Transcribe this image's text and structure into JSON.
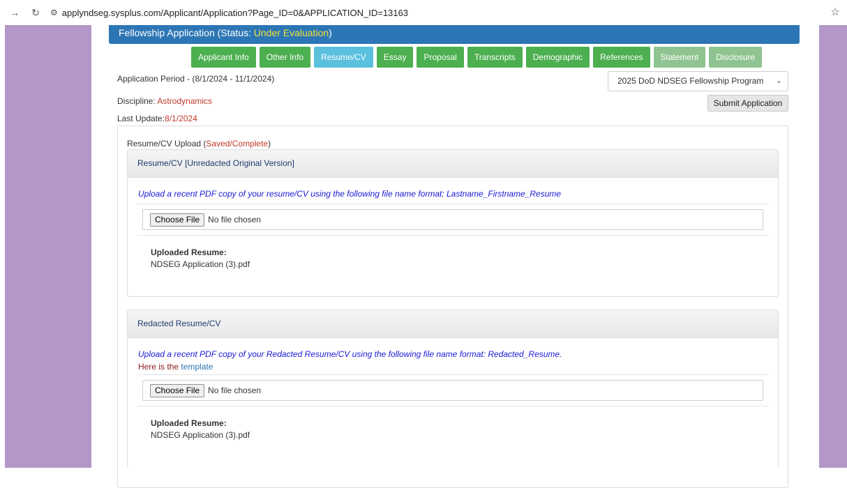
{
  "browser": {
    "url": "applyndseg.sysplus.com/Applicant/Application?Page_ID=0&APPLICATION_ID=13163"
  },
  "header": {
    "title_prefix": "Fellowship Application (Status: ",
    "status": "Under Evaluation",
    "title_suffix": ")"
  },
  "tabs": [
    {
      "label": "Applicant Info",
      "state": "normal"
    },
    {
      "label": "Other Info",
      "state": "normal"
    },
    {
      "label": "Resume/CV",
      "state": "active"
    },
    {
      "label": "Essay",
      "state": "normal"
    },
    {
      "label": "Proposal",
      "state": "normal"
    },
    {
      "label": "Transcripts",
      "state": "normal"
    },
    {
      "label": "Demographic",
      "state": "normal"
    },
    {
      "label": "References",
      "state": "normal"
    },
    {
      "label": "Statement",
      "state": "muted"
    },
    {
      "label": "Disclosure",
      "state": "muted"
    }
  ],
  "info": {
    "period": "Application Period - (8/1/2024 - 11/1/2024)",
    "discipline_label": "Discipline: ",
    "discipline": "Astrodynamics",
    "last_update_label": "Last Update:",
    "last_update": "8/1/2024",
    "program_selected": "2025 DoD NDSEG Fellowship Program",
    "submit_label": "Submit Application"
  },
  "upload": {
    "title": "Resume/CV Upload (",
    "status": "Saved/Complete",
    "title_end": ")"
  },
  "panels": {
    "original": {
      "heading": "Resume/CV [Unredacted Original Version]",
      "instruction": "Upload a recent PDF copy of your resume/CV using the following file name format: Lastname_Firstname_Resume",
      "choose_label": "Choose File",
      "no_file": "No file chosen",
      "uploaded_label": "Uploaded Resume:",
      "uploaded_file": "NDSEG Application (3).pdf"
    },
    "redacted": {
      "heading": "Redacted Resume/CV",
      "instruction": "Upload a recent PDF copy of your Redacted Resume/CV using the following file name format: Redacted_Resume.",
      "template_prefix": "Here is the ",
      "template_link": "template",
      "choose_label": "Choose File",
      "no_file": "No file chosen",
      "uploaded_label": "Uploaded Resume:",
      "uploaded_file": "NDSEG Application (3).pdf"
    }
  },
  "colors": {
    "header_blue": "#2d76b5",
    "status_yellow": "#f0e13c",
    "tab_green": "#4caf50",
    "tab_active": "#5bc0de",
    "side_purple": "#b397c8",
    "value_red": "#c0392b"
  }
}
